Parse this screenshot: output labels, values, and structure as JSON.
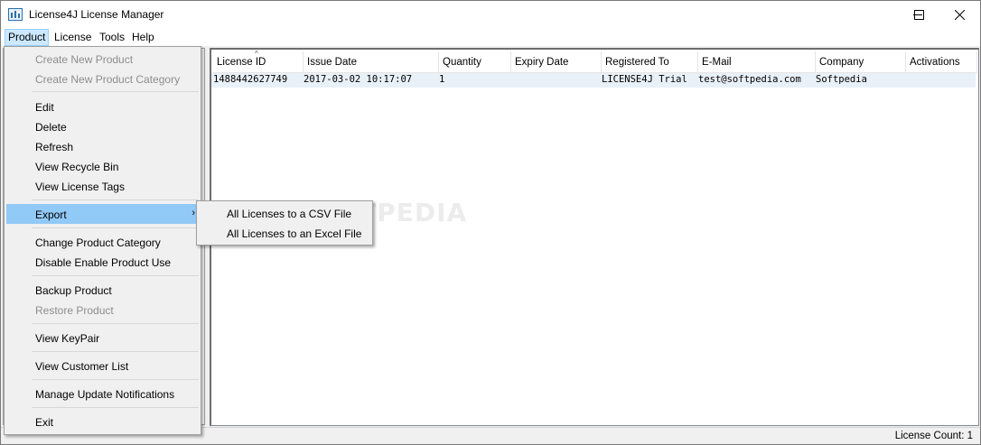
{
  "window": {
    "title": "License4J License Manager",
    "icon": "license-manager-app-icon",
    "controls": {
      "minimize": "minimize-icon",
      "maximize": "maximize-icon",
      "close": "close-icon"
    }
  },
  "menubar": {
    "items": [
      {
        "label": "Product",
        "active": true
      },
      {
        "label": "License"
      },
      {
        "label": "Tools"
      },
      {
        "label": "Help"
      }
    ]
  },
  "product_menu": {
    "items": [
      {
        "label": "Create New Product",
        "disabled": true
      },
      {
        "label": "Create New Product Category",
        "disabled": true
      },
      {
        "label": "Edit"
      },
      {
        "label": "Delete"
      },
      {
        "label": "Refresh"
      },
      {
        "label": "View Recycle Bin"
      },
      {
        "label": "View License Tags"
      },
      {
        "label": "Export",
        "highlighted": true,
        "submenu_arrow": "›"
      },
      {
        "label": "Change Product Category"
      },
      {
        "label": "Disable Enable Product Use"
      },
      {
        "label": "Backup Product"
      },
      {
        "label": "Restore Product",
        "disabled": true
      },
      {
        "label": "View KeyPair"
      },
      {
        "label": "View Customer List"
      },
      {
        "label": "Manage Update Notifications"
      },
      {
        "label": "Exit"
      }
    ]
  },
  "export_submenu": {
    "items": [
      {
        "label": "All Licenses to a CSV File"
      },
      {
        "label": "All Licenses to an Excel File"
      }
    ]
  },
  "table": {
    "sorted_column": "License ID",
    "sort_indicator": "^",
    "columns": [
      "License ID",
      "Issue Date",
      "Quantity",
      "Expiry Date",
      "Registered To",
      "E-Mail",
      "Company",
      "Activations"
    ],
    "rows": [
      [
        "1488442627749",
        "2017-03-02 10:17:07",
        "1",
        "",
        "LICENSE4J Trial",
        "test@softpedia.com",
        "Softpedia",
        ""
      ]
    ]
  },
  "statusbar": {
    "license_count": "License Count: 1"
  },
  "watermark": "SOFTPEDIA",
  "colors": {
    "menu_highlight": "#91c9f7",
    "row_selection": "#e8f0f8",
    "active_menu": "#cce8ff"
  }
}
